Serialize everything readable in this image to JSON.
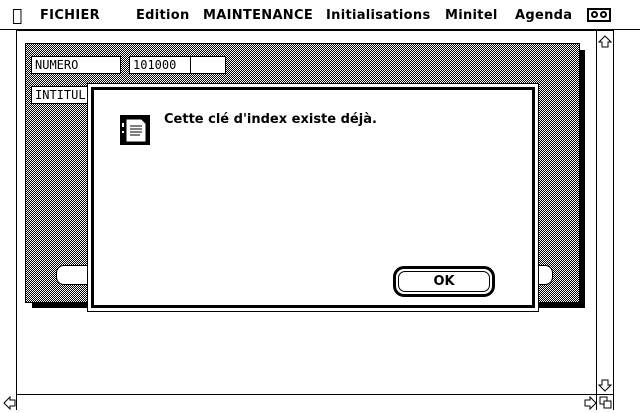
{
  "menu": {
    "apple_glyph": "",
    "items": [
      "FICHIER",
      "Edition",
      "MAINTENANCE",
      "Initialisations",
      "Minitel",
      "Agenda"
    ],
    "clock_icon": "glasses-clock-icon"
  },
  "form": {
    "numero_label": "NUMERO",
    "numero_value": "101000",
    "intitule_label": "INTITUL"
  },
  "alert": {
    "message": "Cette clé d'index existe déjà.",
    "icon": "note-icon",
    "ok_label": "OK"
  },
  "colors": {
    "foreground": "#000000",
    "background": "#ffffff"
  }
}
